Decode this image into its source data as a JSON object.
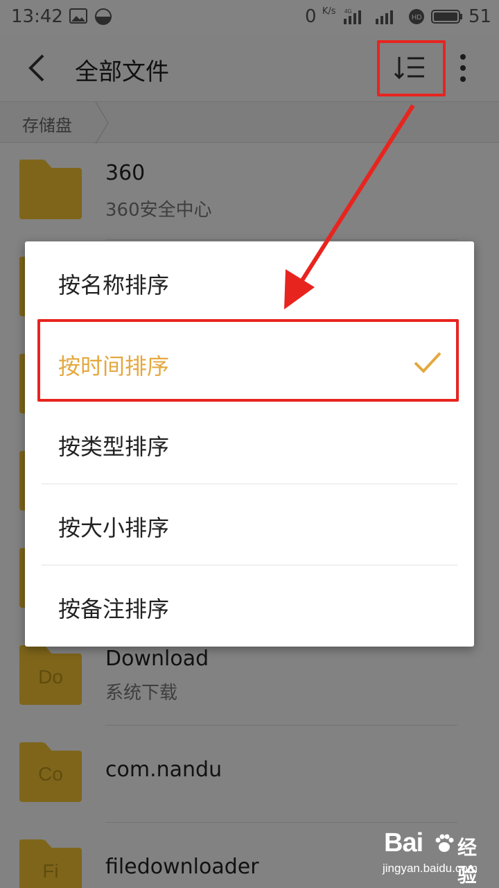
{
  "status_bar": {
    "time": "13:42",
    "net_speed": "0",
    "net_unit": "K/s",
    "battery_level": "51"
  },
  "app_bar": {
    "title": "全部文件",
    "back_icon": "chevron-left-icon",
    "sort_icon": "sort-list-icon",
    "more_icon": "more-vert-icon"
  },
  "breadcrumb": {
    "current": "存储盘"
  },
  "files": [
    {
      "name": "360",
      "subtitle": "360安全中心",
      "folder_label": ""
    },
    {
      "name": "Download",
      "subtitle": "系统下载",
      "folder_label": "Do"
    },
    {
      "name": "com.nandu",
      "subtitle": "",
      "folder_label": "Co"
    },
    {
      "name": "filedownloader",
      "subtitle": "",
      "folder_label": "Fi"
    }
  ],
  "sort_menu": {
    "options": [
      {
        "label": "按名称排序",
        "selected": false
      },
      {
        "label": "按时间排序",
        "selected": true
      },
      {
        "label": "按类型排序",
        "selected": false
      },
      {
        "label": "按大小排序",
        "selected": false
      },
      {
        "label": "按备注排序",
        "selected": false
      }
    ]
  },
  "watermark": {
    "logo": "Bai",
    "logo_cn": "经验",
    "url": "jingyan.baidu.com"
  },
  "colors": {
    "accent": "#e4a83f",
    "folder": "#f1c232",
    "annotation": "#e8241f"
  }
}
